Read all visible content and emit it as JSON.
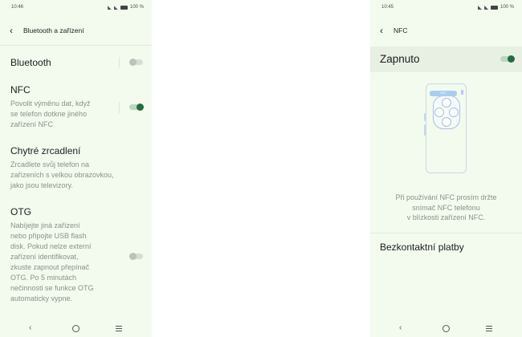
{
  "left_screen": {
    "status_time": "10:46",
    "battery": "100 %",
    "header_title": "Bluetooth a zařízení",
    "items": [
      {
        "title": "Bluetooth",
        "description": "",
        "toggle": "off"
      },
      {
        "title": "NFC",
        "description_lines": [
          "Povolit výměnu dat, když",
          "se telefon dotkne jiného",
          "zařízení NFC"
        ],
        "toggle": "on"
      },
      {
        "title": "Chytré zrcadlení",
        "description_lines": [
          "Zrcadlete svůj telefon na",
          "zařízeních s velkou obrazovkou,",
          "jako jsou televizory."
        ]
      },
      {
        "title": "OTG",
        "description_lines": [
          "Nabíjejte jiná zařízení",
          "nebo připojte USB flash",
          "disk. Pokud nelze externí",
          "zařízení identifikovat,",
          "zkuste zapnout přepínač",
          "OTG. Po 5 minutách",
          "nečinnosti se funkce OTG",
          "automaticky vypne."
        ],
        "toggle": "off"
      }
    ]
  },
  "right_screen": {
    "status_time": "10:45",
    "battery": "100 %",
    "header_title": "NFC",
    "toggle_label": "Zapnuto",
    "toggle": "on",
    "illustration_label": "NFC",
    "description_lines": [
      "Při používání NFC prosím držte",
      "snímač NFC telefonu",
      "v blízkosti zařízení NFC."
    ],
    "contactless_label": "Bezkontaktní platby"
  },
  "colors": {
    "screen_bg": "#f3fbef",
    "toggle_on": "#236b40",
    "toggle_off": "#bcc2b9",
    "secondary_text": "#8b8f89"
  }
}
